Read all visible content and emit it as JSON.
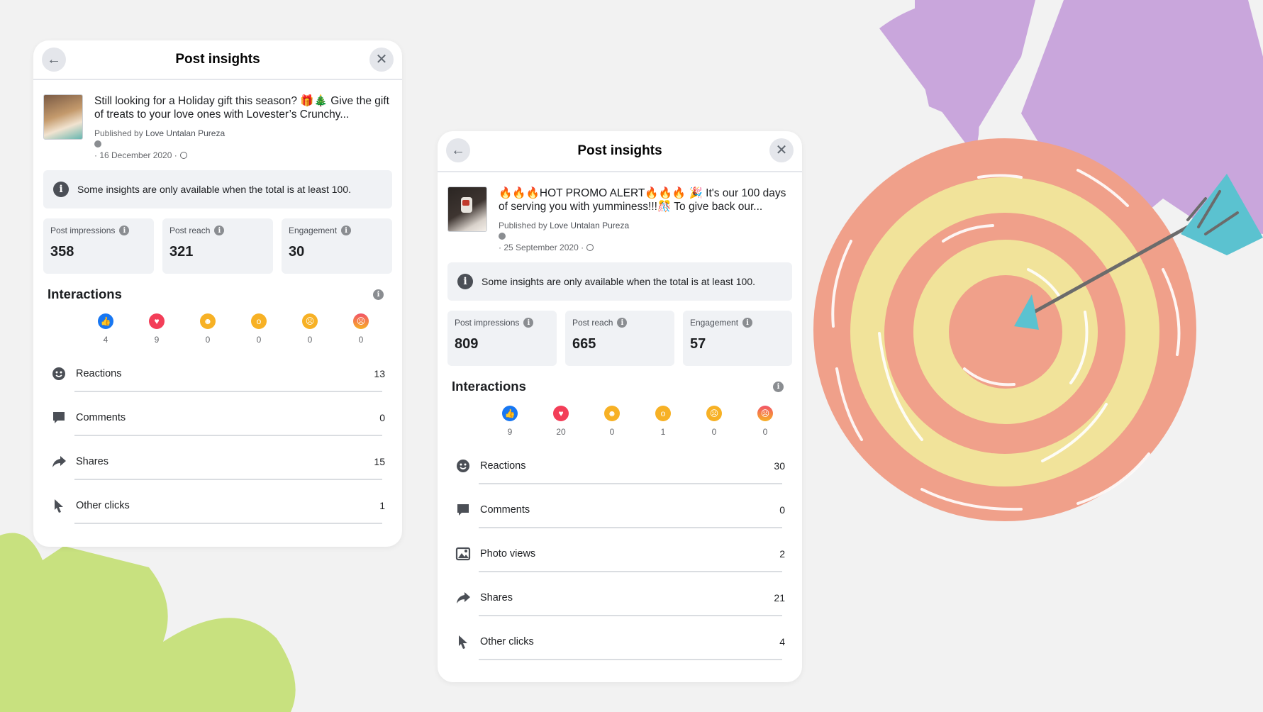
{
  "cards": [
    {
      "header": {
        "title": "Post insights"
      },
      "post": {
        "text": "Still looking for a Holiday gift this season? 🎁🎄 Give the gift of treats to your love ones with Lovester’s Crunchy...",
        "published_prefix": "Published by",
        "published_by": "Love Untalan Pureza",
        "date": "· 16 December 2020 ·"
      },
      "notice": "Some insights are only available when the total is at least 100.",
      "stats": [
        {
          "label": "Post impressions",
          "value": "358"
        },
        {
          "label": "Post reach",
          "value": "321"
        },
        {
          "label": "Engagement",
          "value": "30"
        }
      ],
      "interactions_title": "Interactions",
      "reactions": [
        {
          "icon": "like-icon",
          "count": "4"
        },
        {
          "icon": "love-icon",
          "count": "9"
        },
        {
          "icon": "haha-icon",
          "count": "0"
        },
        {
          "icon": "wow-icon",
          "count": "0"
        },
        {
          "icon": "sad-icon",
          "count": "0"
        },
        {
          "icon": "angry-icon",
          "count": "0"
        }
      ],
      "rows": [
        {
          "icon": "smiley-icon",
          "label": "Reactions",
          "value": "13"
        },
        {
          "icon": "comment-icon",
          "label": "Comments",
          "value": "0"
        },
        {
          "icon": "share-icon",
          "label": "Shares",
          "value": "15"
        },
        {
          "icon": "cursor-icon",
          "label": "Other clicks",
          "value": "1"
        }
      ]
    },
    {
      "header": {
        "title": "Post insights"
      },
      "post": {
        "text": "🔥🔥🔥HOT PROMO ALERT🔥🔥🔥 🎉 It's our 100 days of serving you with yumminess!!!🎊 To give back our...",
        "published_prefix": "Published by",
        "published_by": "Love Untalan Pureza",
        "date": "· 25 September 2020 ·"
      },
      "notice": "Some insights are only available when the total is at least 100.",
      "stats": [
        {
          "label": "Post impressions",
          "value": "809"
        },
        {
          "label": "Post reach",
          "value": "665"
        },
        {
          "label": "Engagement",
          "value": "57"
        }
      ],
      "interactions_title": "Interactions",
      "reactions": [
        {
          "icon": "like-icon",
          "count": "9"
        },
        {
          "icon": "love-icon",
          "count": "20"
        },
        {
          "icon": "haha-icon",
          "count": "0"
        },
        {
          "icon": "wow-icon",
          "count": "1"
        },
        {
          "icon": "sad-icon",
          "count": "0"
        },
        {
          "icon": "angry-icon",
          "count": "0"
        }
      ],
      "rows": [
        {
          "icon": "smiley-icon",
          "label": "Reactions",
          "value": "30"
        },
        {
          "icon": "comment-icon",
          "label": "Comments",
          "value": "0"
        },
        {
          "icon": "photo-icon",
          "label": "Photo views",
          "value": "2"
        },
        {
          "icon": "share-icon",
          "label": "Shares",
          "value": "21"
        },
        {
          "icon": "cursor-icon",
          "label": "Other clicks",
          "value": "4"
        }
      ]
    }
  ],
  "colors": {
    "background": "#f2f2f2",
    "purple_shape": "#c9a6dc",
    "green_shape": "#c8e17f",
    "target_red": "#f0a08a",
    "target_yellow": "#f1e39a",
    "arrow_teal": "#5bc2d0"
  }
}
